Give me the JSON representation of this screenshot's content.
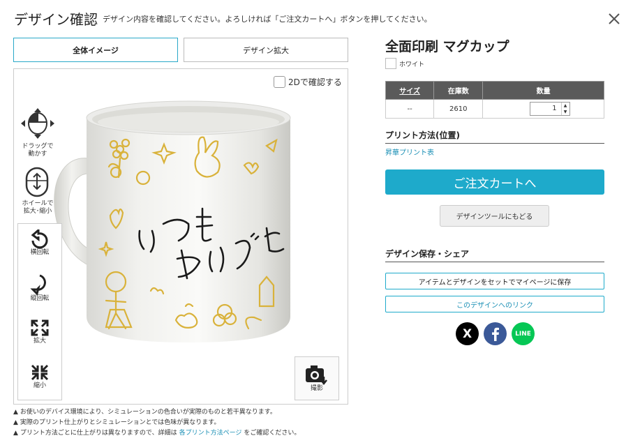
{
  "header": {
    "title": "デザイン確認",
    "subtitle": "デザイン内容を確認してください。よろしければ「ご注文カートへ」ボタンを押してください。"
  },
  "tabs": [
    {
      "label": "全体イメージ",
      "active": true
    },
    {
      "label": "デザイン拡大",
      "active": false
    }
  ],
  "viewer": {
    "check_2d_label": "2Dで確認する",
    "drag_label_1": "ドラッグで",
    "drag_label_2": "動かす",
    "wheel_label_1": "ホイールで",
    "wheel_label_2": "拡大･縮小",
    "rotate_h_label": "横回転",
    "rotate_v_label": "縦回転",
    "zoom_in_label": "拡大",
    "zoom_out_label": "縮小",
    "capture_label": "撮影",
    "mug_text_line1": "いつも",
    "mug_text_line2": "ありがと"
  },
  "notes": {
    "line1": "お使いのデバイス環境により、シミュレーションの色合いが実際のものと若干異なります。",
    "line2": "実際のプリント仕上がりとシミュレーションとでは色味が異なります。",
    "line3_pre": "プリント方法ごとに仕上がりは異なりますので、詳細は",
    "line3_link": "各プリント方法ページ",
    "line3_post": "をご確認ください。"
  },
  "product": {
    "name": "全面印刷 マグカップ",
    "color_label": "ホワイト",
    "color_hex": "#ffffff"
  },
  "stock_table": {
    "headers": [
      "サイズ",
      "在庫数",
      "数量"
    ],
    "row": {
      "size": "--",
      "stock": "2610",
      "quantity": "1"
    }
  },
  "print_method": {
    "heading": "プリント方法(位置)",
    "link": "昇華プリント表"
  },
  "buttons": {
    "cart": "ご注文カートへ",
    "back": "デザインツールにもどる",
    "save": "アイテムとデザインをセットでマイページに保存",
    "link": "このデザインへのリンク"
  },
  "share": {
    "heading": "デザイン保存・シェア",
    "x_label": "X",
    "line_label": "LINE"
  },
  "colors": {
    "accent": "#1eaacb",
    "ink_yellow": "#d9b23a",
    "x_bg": "#000000",
    "facebook_bg": "#3b5998",
    "line_bg": "#06c755"
  }
}
